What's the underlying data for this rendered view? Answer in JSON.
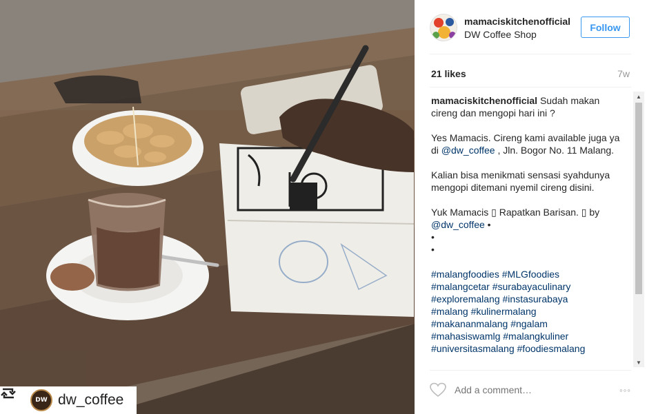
{
  "post": {
    "repost": {
      "badge_username": "dw_coffee",
      "avatar_text": "DW"
    },
    "header": {
      "username": "mamaciskitchenofficial",
      "location": "DW Coffee Shop",
      "follow_label": "Follow"
    },
    "stats": {
      "likes": "21 likes",
      "age": "7w"
    },
    "caption": {
      "author": "mamaciskitchenofficial",
      "line1": "Sudah makan cireng dan mengopi hari ini ?",
      "p2_before": "Yes Mamacis. Cireng kami available juga ya di ",
      "p2_mention": "@dw_coffee",
      "p2_after": " , Jln. Bogor No. 11 Malang.",
      "p3": "Kalian bisa menikmati sensasi syahdunya mengopi ditemani nyemil cireng disini.",
      "p4_before": "Yuk Mamacis ▯ Rapatkan Barisan. ▯ by",
      "p4_mention": "@dw_coffee",
      "p4_after": " •",
      "dot1": "•",
      "dot2": "•",
      "hashtags": [
        "#malangfoodies",
        "#MLGfoodies",
        "#malangcetar",
        "#surabayaculinary",
        "#exploremalang",
        "#instasurabaya",
        "#malang",
        "#kulinermalang",
        "#makananmalang",
        "#ngalam",
        "#mahasiswamlg",
        "#malangkuliner",
        "#universitasmalang",
        "#foodiesmalang"
      ]
    },
    "comment": {
      "placeholder": "Add a comment…",
      "more_label": "◦◦◦"
    }
  },
  "colors": {
    "accent": "#3897f0",
    "link": "#003569",
    "muted": "#999999",
    "text": "#262626"
  },
  "icons": {
    "repost": "repost-icon",
    "heart": "heart-outline-icon",
    "more": "more-options-icon",
    "scroll_up": "scroll-up-arrow-icon",
    "scroll_down": "scroll-down-arrow-icon"
  }
}
